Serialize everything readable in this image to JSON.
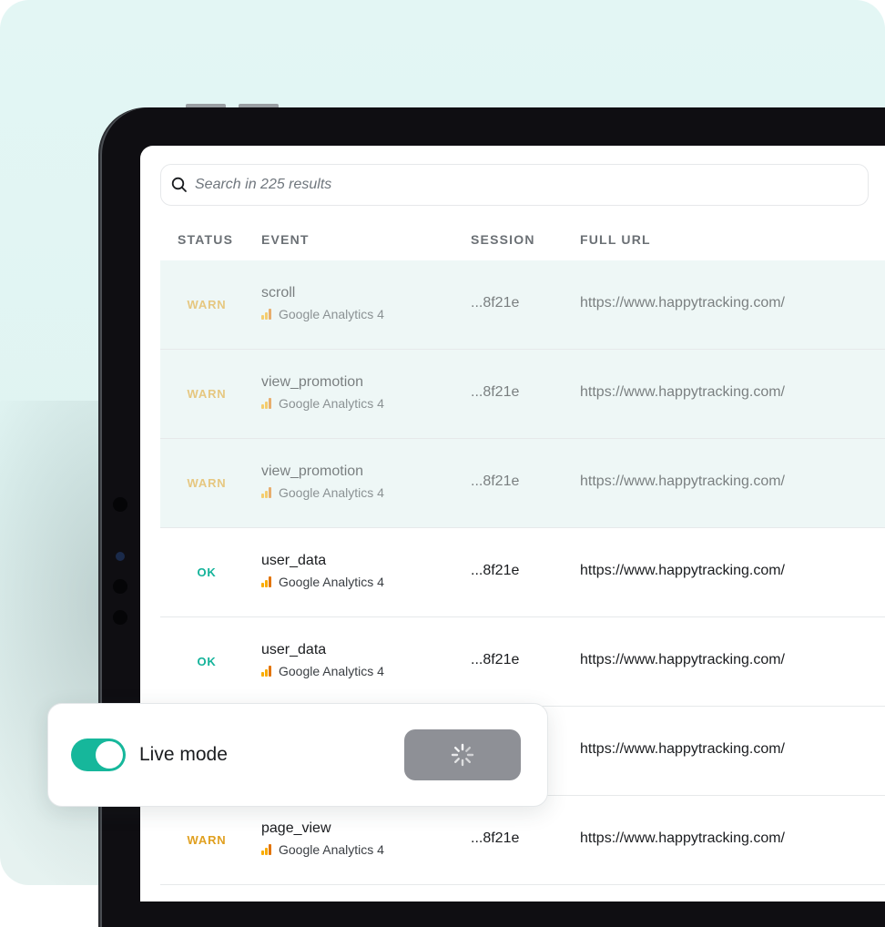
{
  "search": {
    "placeholder": "Search in 225 results"
  },
  "table": {
    "headers": {
      "status": "STATUS",
      "event": "EVENT",
      "session": "SESSION",
      "url": "FULL URL"
    },
    "rows": [
      {
        "status": "WARN",
        "event": "scroll",
        "source": "Google Analytics 4",
        "session": "...8f21e",
        "url": "https://www.happytracking.com/",
        "pending": true
      },
      {
        "status": "WARN",
        "event": "view_promotion",
        "source": "Google Analytics 4",
        "session": "...8f21e",
        "url": "https://www.happytracking.com/",
        "pending": true
      },
      {
        "status": "WARN",
        "event": "view_promotion",
        "source": "Google Analytics 4",
        "session": "...8f21e",
        "url": "https://www.happytracking.com/",
        "pending": true
      },
      {
        "status": "OK",
        "event": "user_data",
        "source": "Google Analytics 4",
        "session": "...8f21e",
        "url": "https://www.happytracking.com/",
        "pending": false
      },
      {
        "status": "OK",
        "event": "user_data",
        "source": "Google Analytics 4",
        "session": "...8f21e",
        "url": "https://www.happytracking.com/",
        "pending": false
      },
      {
        "status": "",
        "event": "",
        "source": "",
        "session": "",
        "url": "https://www.happytracking.com/",
        "pending": false
      },
      {
        "status": "WARN",
        "event": "page_view",
        "source": "Google Analytics 4",
        "session": "...8f21e",
        "url": "https://www.happytracking.com/",
        "pending": false
      }
    ]
  },
  "live_mode": {
    "label": "Live mode",
    "enabled": true,
    "button_icon": "spinner-icon"
  },
  "colors": {
    "accent": "#16b79b",
    "warn": "#e0a020",
    "ok": "#14b39a",
    "background": "#e3f6f4"
  }
}
